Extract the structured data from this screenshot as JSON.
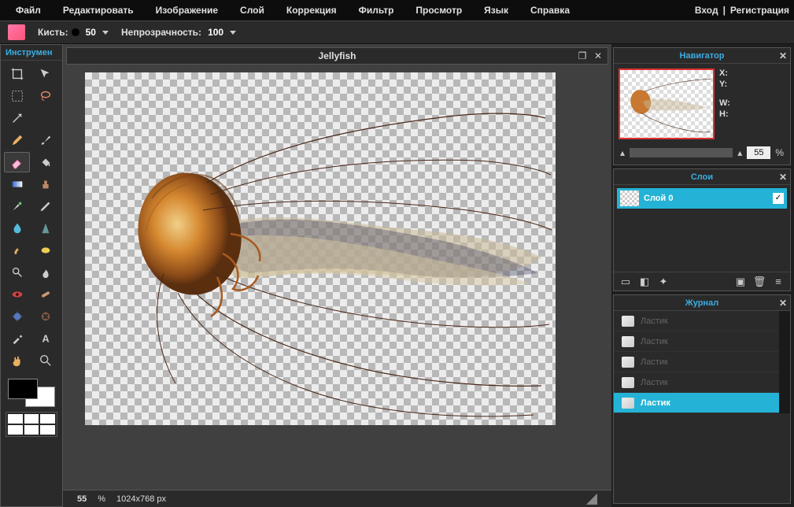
{
  "menu": {
    "items": [
      "Файл",
      "Редактировать",
      "Изображение",
      "Слой",
      "Коррекция",
      "Фильтр",
      "Просмотр",
      "Язык",
      "Справка"
    ],
    "login": "Вход",
    "sep": "|",
    "register": "Регистрация"
  },
  "options": {
    "brush_label": "Кисть:",
    "brush_size": "50",
    "opacity_label": "Непрозрачность:",
    "opacity_value": "100"
  },
  "toolbox": {
    "title": "Инструмен"
  },
  "document": {
    "title": "Jellyfish"
  },
  "status": {
    "zoom": "55",
    "pct": "%",
    "dims": "1024x768 px"
  },
  "navigator": {
    "title": "Навигатор",
    "x_label": "X:",
    "y_label": "Y:",
    "w_label": "W:",
    "h_label": "H:",
    "zoom": "55",
    "pct": "%"
  },
  "layers": {
    "title": "Слои",
    "items": [
      {
        "name": "Слой 0",
        "visible": true
      }
    ]
  },
  "history": {
    "title": "Журнал",
    "items": [
      {
        "label": "Ластик",
        "active": false
      },
      {
        "label": "Ластик",
        "active": false
      },
      {
        "label": "Ластик",
        "active": false
      },
      {
        "label": "Ластик",
        "active": false
      },
      {
        "label": "Ластик",
        "active": true
      }
    ]
  },
  "chart_data": null
}
